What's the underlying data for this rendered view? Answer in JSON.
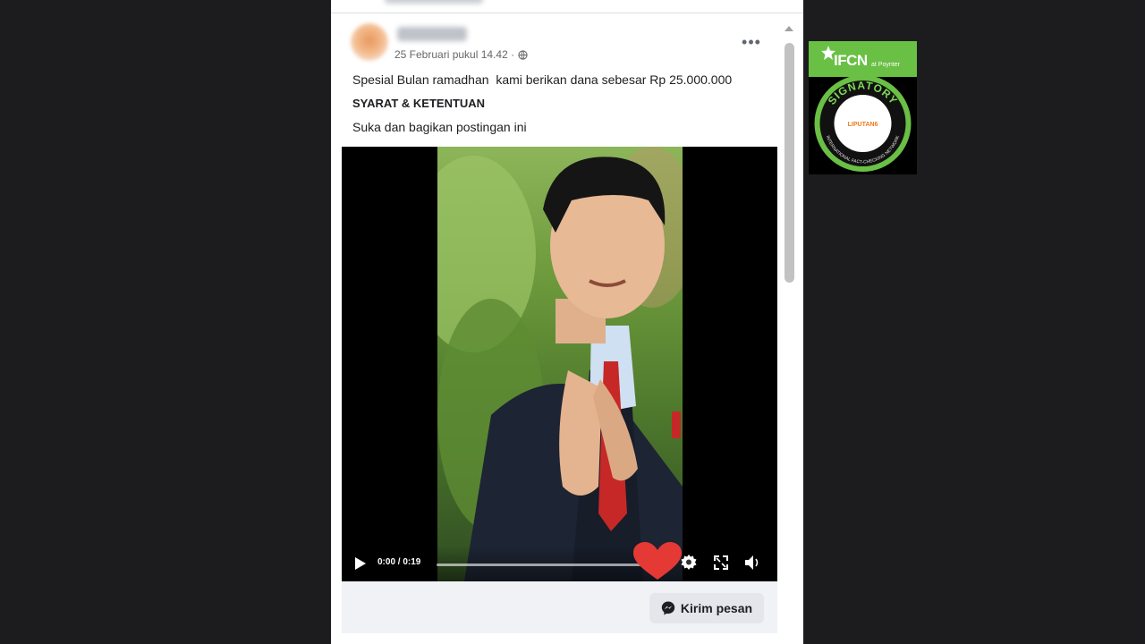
{
  "post": {
    "timestamp": "25 Februari pukul 14.42 ·",
    "text_line1": "Spesial Bulan ramadhan  kami berikan dana sebesar Rp 25.000.000",
    "text_line2": "SYARAT & KETENTUAN",
    "text_line3": "Suka dan bagikan postingan ini",
    "more_label": "•••"
  },
  "video": {
    "time": "0:00 / 0:19",
    "progress_fraction": 0.0
  },
  "footer": {
    "send_message_label": "Kirim pesan"
  },
  "badge": {
    "title": "IFCN",
    "subtitle": "at Poynter",
    "ring_text": "SIGNATORY",
    "bottom_ring_text": "INTERNATIONAL FACT-CHECKING NETWORK",
    "logo_text": "LIPUTAN6"
  },
  "colors": {
    "background": "#1c1c1e",
    "badge_green": "#6abf45",
    "heart_red": "#e53935"
  }
}
